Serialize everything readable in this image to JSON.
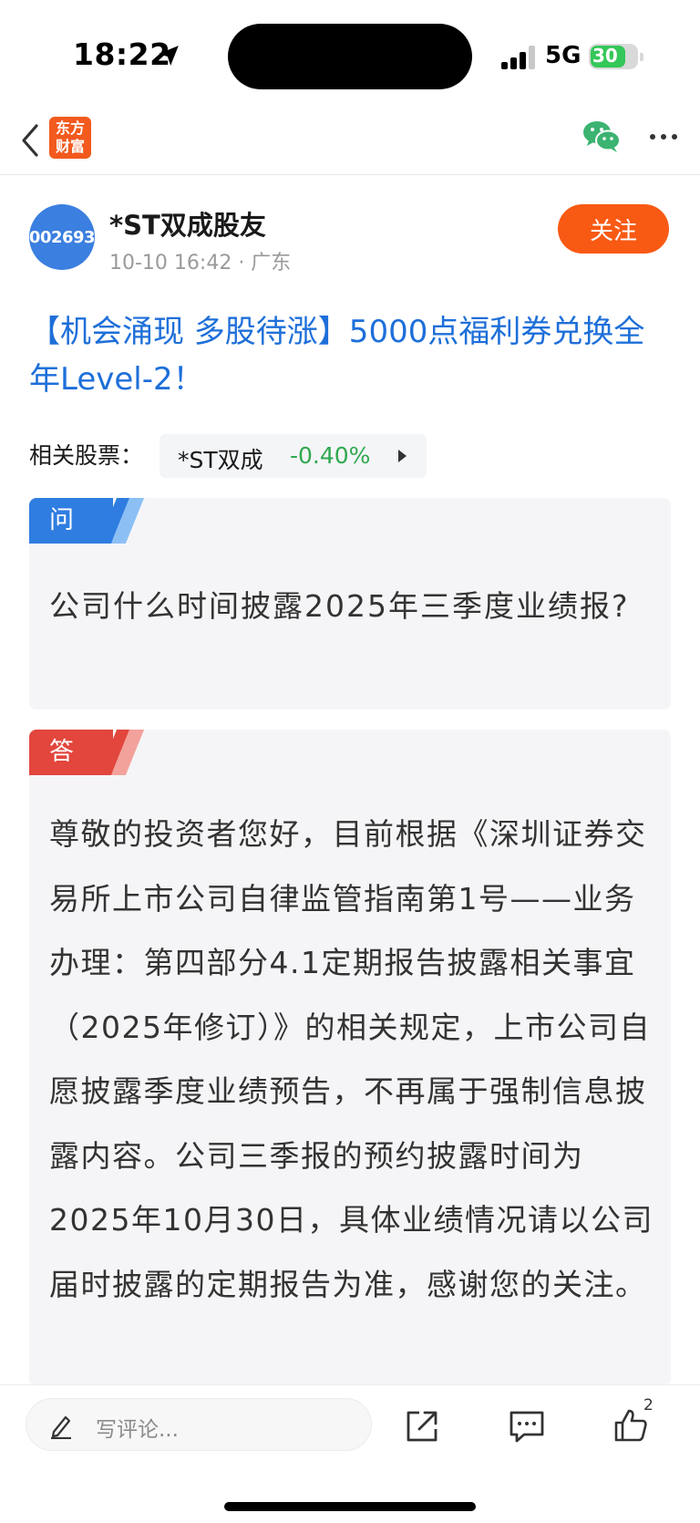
{
  "status_bar": {
    "time": "18:22",
    "network": "5G",
    "battery": "30"
  },
  "nav": {
    "app_logo_line1": "东方",
    "app_logo_line2": "财富",
    "back_icon": "chevron-left-icon",
    "share_icon": "wechat-icon",
    "more_icon": "more-dots-icon"
  },
  "author": {
    "avatar_code": "002693",
    "name": "*ST双成股友",
    "meta": "10-10 16:42 · 广东",
    "follow_label": "关注"
  },
  "post": {
    "title": "【机会涌现 多股待涨】5000点福利券兑换全年Level-2！"
  },
  "related": {
    "label": "相关股票：",
    "stock_name": "*ST双成",
    "stock_change": "-0.40%"
  },
  "qa": {
    "question_tag": "问",
    "question": "公司什么时间披露2025年三季度业绩报?",
    "answer_tag": "答",
    "answer": "尊敬的投资者您好，目前根据《深圳证券交易所上市公司自律监管指南第1号——业务办理：第四部分4.1定期报告披露相关事宜（2025年修订）》的相关规定，上市公司自愿披露季度业绩预告，不再属于强制信息披露内容。公司三季报的预约披露时间为2025年10月30日，具体业绩情况请以公司届时披露的定期报告为准，感谢您的关注。"
  },
  "bottom_bar": {
    "comment_placeholder": "写评论...",
    "like_count": "2"
  },
  "colors": {
    "brand": "#f25a1e",
    "title_blue": "#1e6fd9",
    "follow": "#f85a14",
    "stock_green": "#2fa84f",
    "question_tag": "#2f7de1",
    "answer_tag": "#e2463d"
  }
}
